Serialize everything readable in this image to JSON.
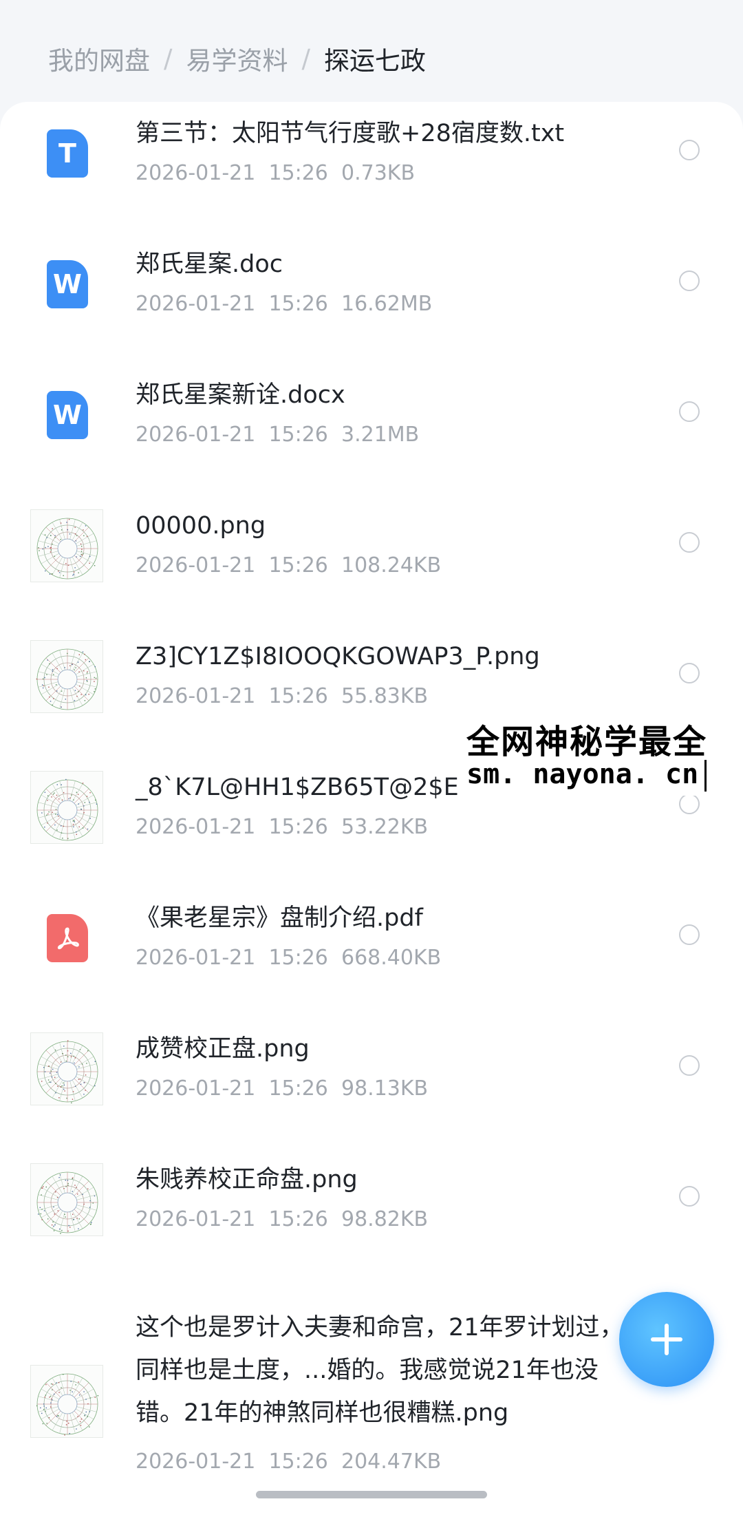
{
  "breadcrumb": {
    "root": "我的网盘",
    "parent": "易学资料",
    "separator": "/",
    "current": "探运七政"
  },
  "files": [
    {
      "type": "txt",
      "icon": "txt-file-icon",
      "icon_letter": "T",
      "name": "第三节：太阳节气行度歌+28宿度数.txt",
      "date": "2026-01-21",
      "time": "15:26",
      "size": "0.73KB"
    },
    {
      "type": "doc",
      "icon": "word-file-icon",
      "icon_letter": "W",
      "name": "郑氏星案.doc",
      "date": "2026-01-21",
      "time": "15:26",
      "size": "16.62MB"
    },
    {
      "type": "doc",
      "icon": "word-file-icon",
      "icon_letter": "W",
      "name": "郑氏星案新诠.docx",
      "date": "2026-01-21",
      "time": "15:26",
      "size": "3.21MB"
    },
    {
      "type": "png",
      "icon": "image-thumbnail",
      "name": "00000.png",
      "date": "2026-01-21",
      "time": "15:26",
      "size": "108.24KB"
    },
    {
      "type": "png",
      "icon": "image-thumbnail",
      "name": "Z3]CY1Z$I8IOOQKGOWAP3_P.png",
      "date": "2026-01-21",
      "time": "15:26",
      "size": "55.83KB"
    },
    {
      "type": "png",
      "icon": "image-thumbnail",
      "name": "_8`K7L@HH1$ZB65T@2$E",
      "date": "2026-01-21",
      "time": "15:26",
      "size": "53.22KB"
    },
    {
      "type": "pdf",
      "icon": "pdf-file-icon",
      "name": "《果老星宗》盘制介绍.pdf",
      "date": "2026-01-21",
      "time": "15:26",
      "size": "668.40KB"
    },
    {
      "type": "png",
      "icon": "image-thumbnail",
      "name": "成赞校正盘.png",
      "date": "2026-01-21",
      "time": "15:26",
      "size": "98.13KB"
    },
    {
      "type": "png",
      "icon": "image-thumbnail",
      "name": "朱贱养校正命盘.png",
      "date": "2026-01-21",
      "time": "15:26",
      "size": "98.82KB"
    },
    {
      "type": "png",
      "icon": "image-thumbnail",
      "name": "这个也是罗计入夫妻和命宫，21年罗计划过，同样也是土度，...婚的。我感觉说21年也没错。21年的神煞同样也很糟糕.png",
      "date": "2026-01-21",
      "time": "15:26",
      "size": "204.47KB"
    }
  ],
  "watermark": {
    "title": "全网神秘学最全",
    "url": "sm. nayona. cn"
  },
  "fab": {
    "icon": "plus-icon",
    "color": "#2a8ff5"
  },
  "colors": {
    "accent": "#3d8ff5",
    "pdf": "#f26b6b",
    "meta_text": "#a3a8af"
  }
}
